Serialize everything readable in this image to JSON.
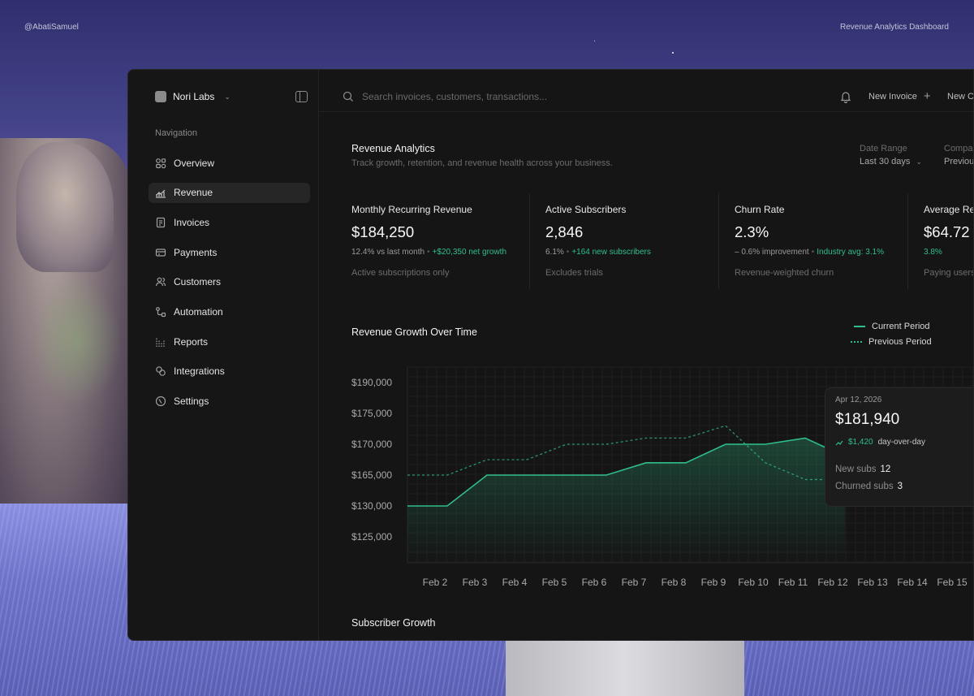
{
  "page": {
    "author_handle": "@AbatiSamuel",
    "project_label": "Revenue Analytics Dashboard"
  },
  "sidebar": {
    "org_name": "Nori Labs",
    "nav_heading": "Navigation",
    "items": [
      {
        "label": "Overview",
        "icon": "overview-icon",
        "active": false
      },
      {
        "label": "Revenue",
        "icon": "revenue-icon",
        "active": true
      },
      {
        "label": "Invoices",
        "icon": "invoices-icon",
        "active": false
      },
      {
        "label": "Payments",
        "icon": "payments-icon",
        "active": false
      },
      {
        "label": "Customers",
        "icon": "customers-icon",
        "active": false
      },
      {
        "label": "Automation",
        "icon": "automation-icon",
        "active": false
      },
      {
        "label": "Reports",
        "icon": "reports-icon",
        "active": false
      },
      {
        "label": "Integrations",
        "icon": "integrations-icon",
        "active": false
      },
      {
        "label": "Settings",
        "icon": "settings-icon",
        "active": false
      }
    ]
  },
  "topbar": {
    "search_placeholder": "Search invoices, customers, transactions...",
    "new_invoice_label": "New Invoice",
    "new_customer_label": "New C"
  },
  "header": {
    "title": "Revenue Analytics",
    "subtitle": "Track growth, retention, and revenue health across your business.",
    "date_range_label": "Date Range",
    "date_range_value": "Last 30 days",
    "compare_label": "Compa",
    "compare_value": "Previous"
  },
  "kpis": [
    {
      "label": "Monthly Recurring Revenue",
      "value": "$184,250",
      "meta": "12.4% vs last month",
      "meta_positive": "+$20,350 net growth",
      "note": "Active subscriptions only"
    },
    {
      "label": "Active Subscribers",
      "value": "2,846",
      "meta": "6.1%",
      "meta_positive": "+164 new subscribers",
      "note": "Excludes trials"
    },
    {
      "label": "Churn Rate",
      "value": "2.3%",
      "meta": "– 0.6% improvement",
      "meta_positive": "Industry avg: 3.1%",
      "note": "Revenue-weighted churn"
    },
    {
      "label": "Average Re",
      "value": "$64.72",
      "meta": "",
      "meta_positive": "3.8%",
      "note": "Paying users"
    }
  ],
  "chart": {
    "title": "Revenue Growth Over Time",
    "legend_current": "Current Period",
    "legend_previous": "Previous Period",
    "accent_color": "#2fbf8a"
  },
  "chart_data": {
    "type": "line",
    "title": "Revenue Growth Over Time",
    "y_tick_labels": [
      "$190,000",
      "$175,000",
      "$170,000",
      "$165,000",
      "$130,000",
      "$125,000"
    ],
    "categories": [
      "Feb 2",
      "Feb 3",
      "Feb 4",
      "Feb 5",
      "Feb 6",
      "Feb 7",
      "Feb 8",
      "Feb 9",
      "Feb 10",
      "Feb 11",
      "Feb 12",
      "Feb 13",
      "Feb 14",
      "Feb 15"
    ],
    "series": [
      {
        "name": "Current Period",
        "style": "solid",
        "values": [
          130000,
          130000,
          165000,
          165000,
          165000,
          165000,
          167000,
          167000,
          170000,
          170000,
          171000,
          168000,
          167500,
          167500
        ]
      },
      {
        "name": "Previous Period",
        "style": "dotted",
        "values": [
          165000,
          165000,
          167500,
          167500,
          170000,
          170000,
          171000,
          171000,
          173000,
          167000,
          160000,
          160000,
          160000,
          160000
        ]
      }
    ],
    "grid": true,
    "legend": "top-right"
  },
  "tooltip": {
    "date": "Apr 12, 2026",
    "value": "$181,940",
    "change": "$1,420",
    "change_label": "day-over-day",
    "new_subs_label": "New subs",
    "new_subs_value": "12",
    "churned_label": "Churned subs",
    "churned_value": "3"
  },
  "sections": {
    "subscriber_growth": "Subscriber Growth"
  }
}
